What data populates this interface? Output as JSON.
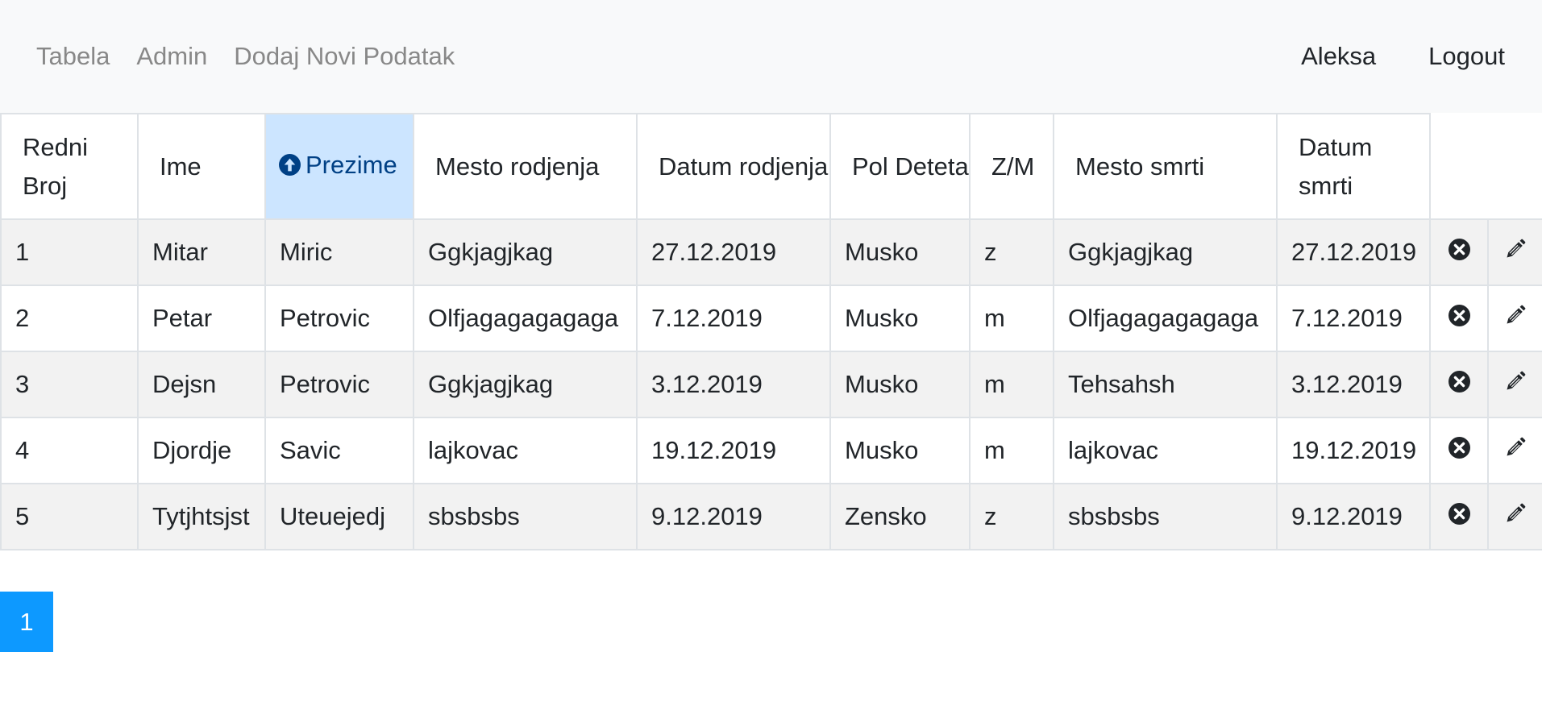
{
  "nav": {
    "links": [
      "Tabela",
      "Admin",
      "Dodaj Novi Podatak"
    ],
    "user": "Aleksa",
    "logout": "Logout"
  },
  "table": {
    "headers": [
      "Redni Broj",
      "Ime",
      "Prezime",
      "Mesto rodjenja",
      "Datum rodjenja",
      "Pol Deteta",
      "Z/M",
      "Mesto smrti",
      "Datum smrti"
    ],
    "sorted_column": "Prezime",
    "sort_direction": "ascending",
    "rows": [
      [
        "1",
        "Mitar",
        "Miric",
        "Ggkjagjkag",
        "27.12.2019",
        "Musko",
        "z",
        "Ggkjagjkag",
        "27.12.2019"
      ],
      [
        "2",
        "Petar",
        "Petrovic",
        "Olfjagagagagaga",
        "7.12.2019",
        "Musko",
        "m",
        "Olfjagagagagaga",
        "7.12.2019"
      ],
      [
        "3",
        "Dejsn",
        "Petrovic",
        "Ggkjagjkag",
        "3.12.2019",
        "Musko",
        "m",
        "Tehsahsh",
        "3.12.2019"
      ],
      [
        "4",
        "Djordje",
        "Savic",
        "lajkovac",
        "19.12.2019",
        "Musko",
        "m",
        "lajkovac",
        "19.12.2019"
      ],
      [
        "5",
        "Tytjhtsjst",
        "Uteuejedj",
        "sbsbsbs",
        "9.12.2019",
        "Zensko",
        "z",
        "sbsbsbs",
        "9.12.2019"
      ]
    ],
    "row_actions": [
      "delete-icon",
      "edit-icon"
    ]
  },
  "pagination": {
    "current": "1"
  },
  "colors": {
    "nav_bg": "#f8f9fa",
    "sorted_header_bg": "#cce5ff",
    "sorted_header_text": "#004085",
    "page_button": "#0d99ff",
    "stripe": "#f2f2f2"
  }
}
